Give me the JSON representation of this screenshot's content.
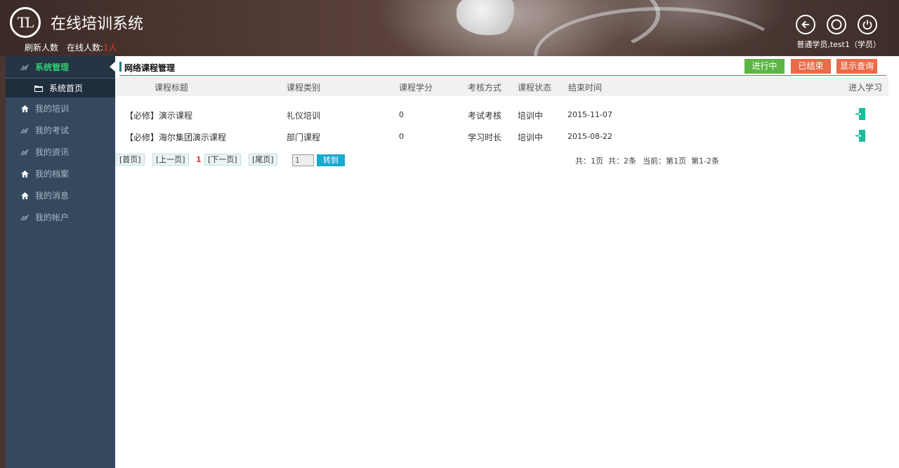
{
  "header": {
    "logo_text": "TL",
    "app_title": "在线培训系统",
    "refresh_label": "刷新人数",
    "online_label": "在线人数:",
    "online_value": "1人",
    "user_info": "普通学员,test1（学员）",
    "icons": [
      "back-icon",
      "refresh-icon",
      "power-icon"
    ]
  },
  "sidebar": {
    "head": "系统管理",
    "sub": "系统首页",
    "items": [
      {
        "label": "我的培训",
        "icon": "home-icon"
      },
      {
        "label": "我的考试",
        "icon": "stripes-icon"
      },
      {
        "label": "我的资讯",
        "icon": "stripes-icon"
      },
      {
        "label": "我的档案",
        "icon": "home-icon"
      },
      {
        "label": "我的消息",
        "icon": "home-icon"
      },
      {
        "label": "我的帐户",
        "icon": "stripes-icon"
      }
    ]
  },
  "main": {
    "title": "网络课程管理",
    "buttons": {
      "in_progress": "进行中",
      "finished": "已结束",
      "show_query": "显示查询"
    },
    "columns": [
      "课程标题",
      "课程类别",
      "课程学分",
      "考核方式",
      "课程状态",
      "结束时间",
      "进入学习"
    ],
    "rows": [
      {
        "title": "【必修】演示课程",
        "category": "礼仪培训",
        "credit": "0",
        "method": "考试考核",
        "status": "培训中",
        "end": "2015-11-07"
      },
      {
        "title": "【必修】海尔集团演示课程",
        "category": "部门课程",
        "credit": "0",
        "method": "学习时长",
        "status": "培训中",
        "end": "2015-08-22"
      }
    ],
    "pager": {
      "first": "[首页]",
      "prev": "[上一页]",
      "current": "1",
      "next": "[下一页]",
      "last": "[尾页]",
      "input_value": "1",
      "go": "转到",
      "total_pages": "共：1页",
      "total_items": "共：2条",
      "current_page": "当前：第1页",
      "range": "第1-2条"
    }
  },
  "colors": {
    "sidebar_bg": "#34495e",
    "accent_green": "#2ecc71",
    "btn_green": "#5cb545",
    "btn_orange": "#ea6a49",
    "go_blue": "#1aa9d2",
    "enter_icon": "#1abc9c"
  }
}
